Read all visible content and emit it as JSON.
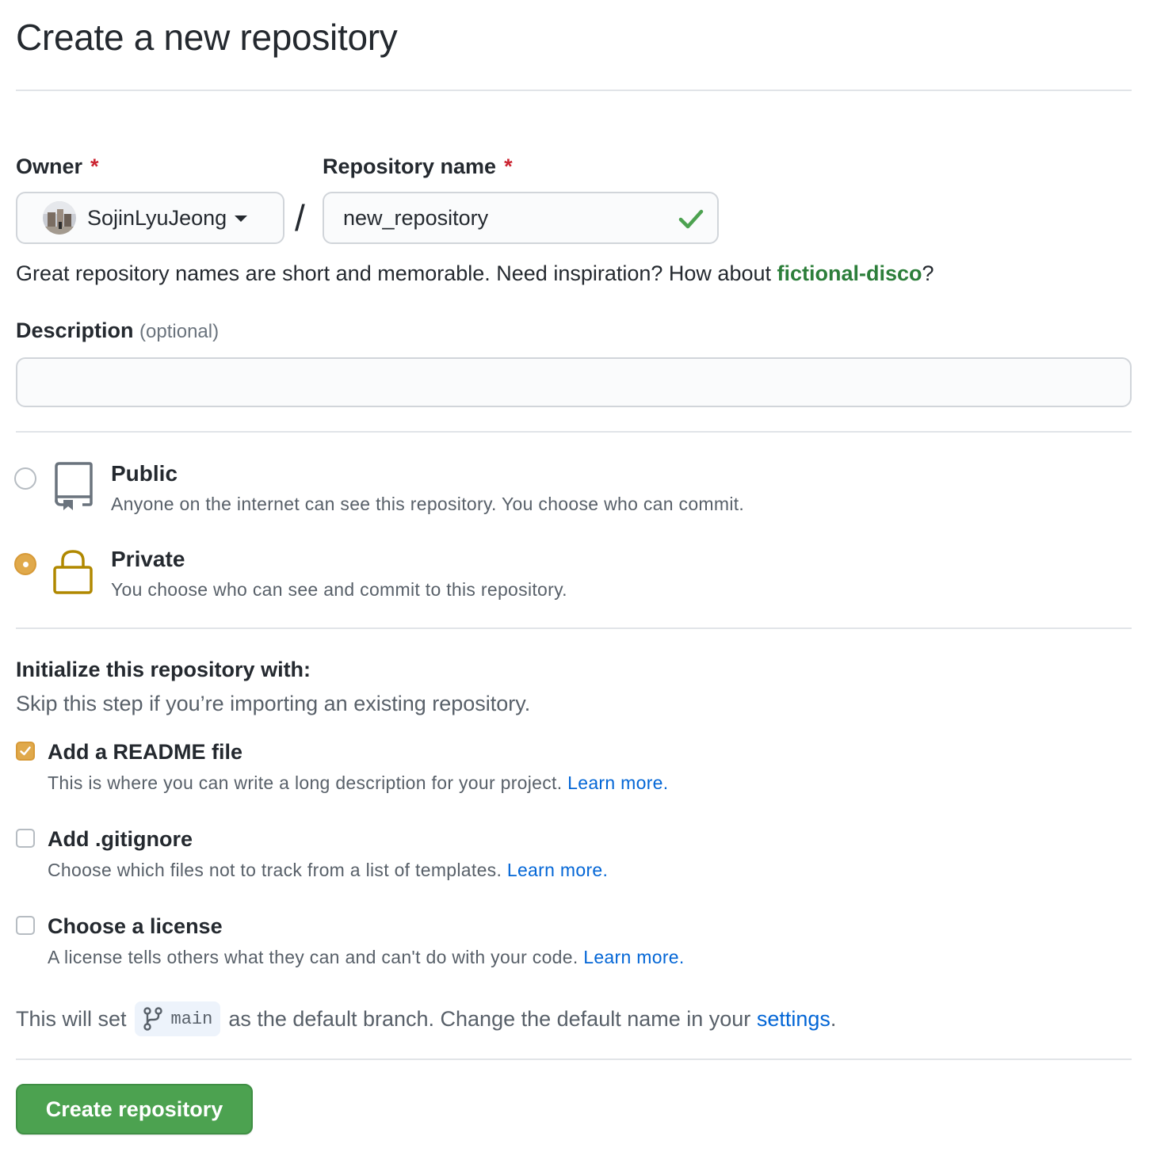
{
  "page": {
    "title": "Create a new repository"
  },
  "owner": {
    "label": "Owner",
    "required_mark": "*",
    "name": "SojinLyuJeong"
  },
  "repo_name": {
    "label": "Repository name",
    "required_mark": "*",
    "value": "new_repository",
    "valid": true
  },
  "separator": "/",
  "hint": {
    "text": "Great repository names are short and memorable. Need inspiration? How about ",
    "suggestion": "fictional-disco",
    "suffix": "?"
  },
  "description": {
    "label": "Description",
    "optional": "(optional)",
    "value": ""
  },
  "visibility": {
    "selected": "private",
    "options": [
      {
        "id": "public",
        "title": "Public",
        "desc": "Anyone on the internet can see this repository. You choose who can commit.",
        "icon": "repo-icon"
      },
      {
        "id": "private",
        "title": "Private",
        "desc": "You choose who can see and commit to this repository.",
        "icon": "lock-icon"
      }
    ]
  },
  "init": {
    "title": "Initialize this repository with:",
    "subtitle": "Skip this step if you’re importing an existing repository.",
    "options": [
      {
        "id": "readme",
        "title": "Add a README file",
        "desc": "This is where you can write a long description for your project.",
        "link": "Learn more.",
        "checked": true
      },
      {
        "id": "gitignore",
        "title": "Add .gitignore",
        "desc": "Choose which files not to track from a list of templates.",
        "link": "Learn more.",
        "checked": false
      },
      {
        "id": "license",
        "title": "Choose a license",
        "desc": "A license tells others what they can and can't do with your code.",
        "link": "Learn more.",
        "checked": false
      }
    ]
  },
  "branch": {
    "prefix": "This will set",
    "name": "main",
    "middle": "as the default branch. Change the default name in your",
    "link": "settings",
    "suffix": "."
  },
  "submit": {
    "label": "Create repository"
  },
  "colors": {
    "accent_orange": "#e0a94b",
    "lock_gold": "#b08800",
    "success_green": "#4ca250",
    "link_blue": "#0366d6",
    "required_red": "#cb2431"
  }
}
